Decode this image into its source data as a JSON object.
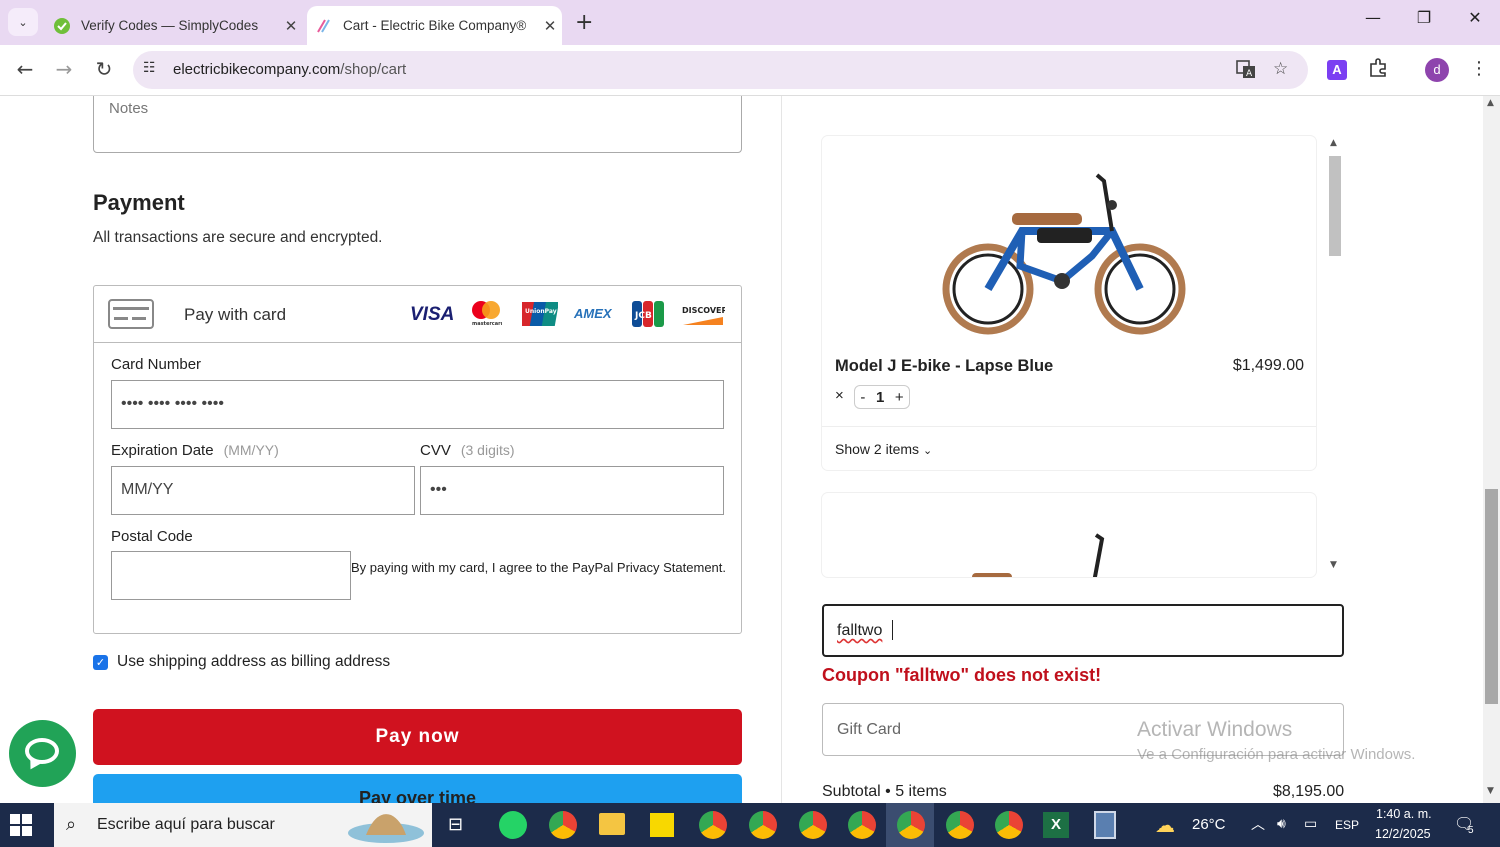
{
  "browser": {
    "tabs": [
      {
        "title": "Verify Codes — SimplyCodes",
        "active": false
      },
      {
        "title": "Cart - Electric Bike Company®",
        "active": true
      }
    ],
    "url_domain": "electricbikecompany.com",
    "url_path": "/shop/cart",
    "profile_initial": "d",
    "ext_label": "A"
  },
  "checkout": {
    "notes_placeholder": "Notes",
    "payment_heading": "Payment",
    "payment_sub": "All transactions are secure and encrypted.",
    "pay_with_card": "Pay with card",
    "brands": [
      "VISA",
      "mastercard",
      "UnionPay",
      "AMEX",
      "JCB",
      "DISCOVER"
    ],
    "card_number_label": "Card Number",
    "card_number_value": "•••• •••• •••• ••••",
    "exp_label": "Expiration Date",
    "exp_hint": "(MM/YY)",
    "exp_placeholder": "MM/YY",
    "cvv_label": "CVV",
    "cvv_hint": "(3 digits)",
    "cvv_value": "•••",
    "postal_label": "Postal Code",
    "agree_text": "By paying with my card, I agree to the PayPal Privacy Statement.",
    "billing_checkbox_label": "Use shipping address as billing address",
    "billing_checked": true,
    "pay_now": "Pay now",
    "pay_over_time": "Pay over time"
  },
  "cart": {
    "product_name": "Model J E-bike - Lapse Blue",
    "product_price": "$1,499.00",
    "qty_prefix": "×",
    "qty_minus": "-",
    "qty": "1",
    "qty_plus": "+",
    "show_items": "Show 2 items",
    "coupon_value": "falltwo",
    "coupon_error": "Coupon \"falltwo\" does not exist!",
    "gift_placeholder": "Gift Card",
    "subtotal_label": "Subtotal • 5 items",
    "subtotal_value": "$8,195.00",
    "bike_frame_color": "#1f5fb5"
  },
  "watermark": {
    "line1": "Activar Windows",
    "line2": "Ve a Configuración para activar Windows."
  },
  "taskbar": {
    "search_placeholder": "Escribe aquí para buscar",
    "temperature": "26°C",
    "language": "ESP",
    "time": "1:40 a. m.",
    "date": "12/2/2025",
    "notifications": "5"
  }
}
